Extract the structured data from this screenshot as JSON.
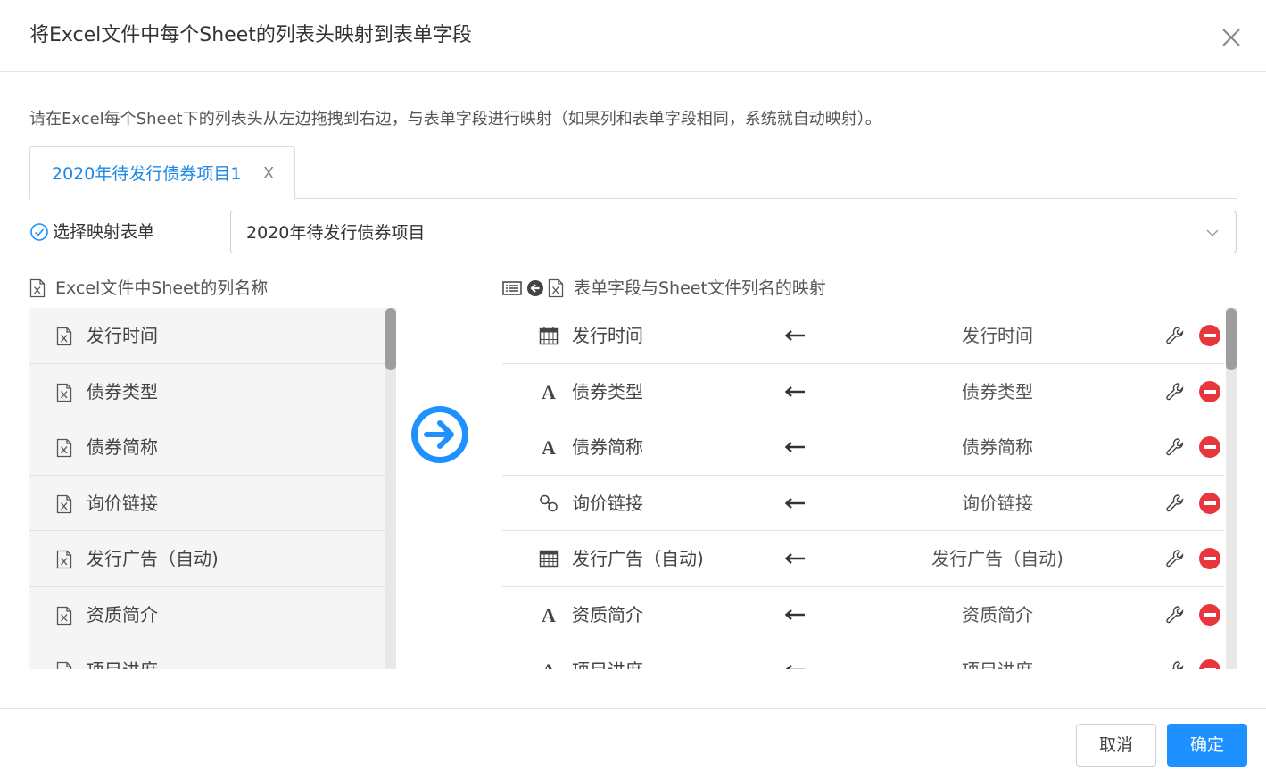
{
  "dialog": {
    "title": "将Excel文件中每个Sheet的列表头映射到表单字段",
    "instruction": "请在Excel每个Sheet下的列表头从左边拖拽到右边，与表单字段进行映射（如果列和表单字段相同，系统就自动映射）。"
  },
  "tabs": [
    {
      "label": "2020年待发行债券项目1",
      "close": "X"
    }
  ],
  "mapping": {
    "label": "选择映射表单",
    "selected_form": "2020年待发行债券项目"
  },
  "left_section": {
    "title": "Excel文件中Sheet的列名称",
    "items": [
      {
        "label": "发行时间"
      },
      {
        "label": "债券类型"
      },
      {
        "label": "债券简称"
      },
      {
        "label": "询价链接"
      },
      {
        "label": "发行广告（自动)"
      },
      {
        "label": "资质简介"
      },
      {
        "label": "项目进度"
      }
    ]
  },
  "right_section": {
    "title": "表单字段与Sheet文件列名的映射",
    "rows": [
      {
        "field": "发行时间",
        "type_icon": "calendar-icon",
        "column": "发行时间"
      },
      {
        "field": "债券类型",
        "type_icon": "text-icon",
        "column": "债券类型"
      },
      {
        "field": "债券简称",
        "type_icon": "text-icon",
        "column": "债券简称"
      },
      {
        "field": "询价链接",
        "type_icon": "link-icon",
        "column": "询价链接"
      },
      {
        "field": "发行广告（自动)",
        "type_icon": "table-icon",
        "column": "发行广告（自动)"
      },
      {
        "field": "资质简介",
        "type_icon": "text-icon",
        "column": "资质简介"
      },
      {
        "field": "项目进度",
        "type_icon": "text-icon",
        "column": "项目进度"
      }
    ]
  },
  "footer": {
    "cancel_label": "取消",
    "ok_label": "确定"
  },
  "colors": {
    "accent": "#1e90ff",
    "tab_text": "#1e88e5",
    "remove": "#e8363d",
    "list_bg": "#f5f5f5"
  }
}
